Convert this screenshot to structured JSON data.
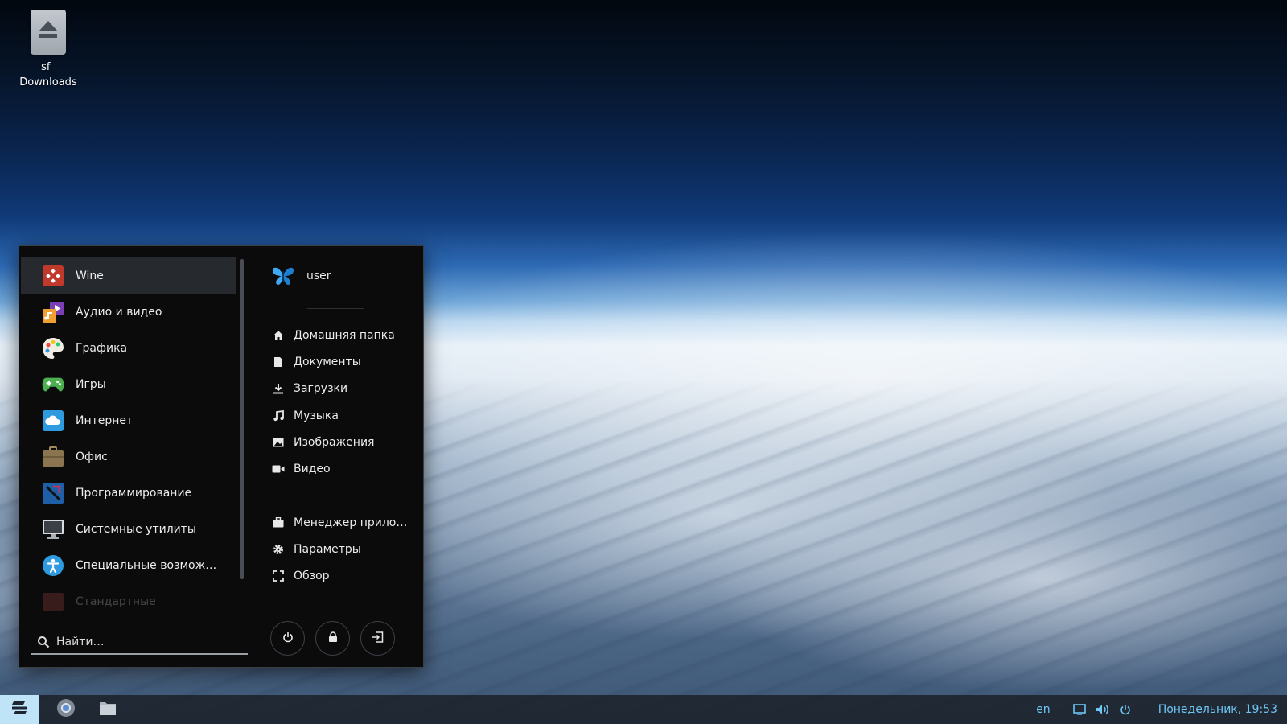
{
  "desktop": {
    "icon": {
      "label_line1": "sf_",
      "label_line2": "Downloads",
      "icon": "eject-drive-icon"
    }
  },
  "menu": {
    "categories": [
      {
        "label": "Wine",
        "icon": "wine-icon",
        "active": true
      },
      {
        "label": "Аудио и видео",
        "icon": "audio-video-icon"
      },
      {
        "label": "Графика",
        "icon": "palette-icon"
      },
      {
        "label": "Игры",
        "icon": "gamepad-icon"
      },
      {
        "label": "Интернет",
        "icon": "cloud-icon"
      },
      {
        "label": "Офис",
        "icon": "briefcase-icon"
      },
      {
        "label": "Программирование",
        "icon": "programming-icon"
      },
      {
        "label": "Системные утилиты",
        "icon": "monitor-icon"
      },
      {
        "label": "Специальные возмож…",
        "icon": "accessibility-icon"
      },
      {
        "label": "Стандартные",
        "icon": "accessories-icon"
      }
    ],
    "search": {
      "placeholder": "Найти…"
    },
    "user": {
      "name": "user",
      "icon": "butterfly-icon"
    },
    "places": [
      {
        "label": "Домашняя папка",
        "icon": "home-icon"
      },
      {
        "label": "Документы",
        "icon": "document-icon"
      },
      {
        "label": "Загрузки",
        "icon": "download-icon"
      },
      {
        "label": "Музыка",
        "icon": "music-icon"
      },
      {
        "label": "Изображения",
        "icon": "image-icon"
      },
      {
        "label": "Видео",
        "icon": "video-icon"
      }
    ],
    "system": [
      {
        "label": "Менеджер прило…",
        "icon": "software-icon"
      },
      {
        "label": "Параметры",
        "icon": "gear-icon"
      },
      {
        "label": "Обзор",
        "icon": "overview-icon"
      }
    ],
    "actions": [
      "power-icon",
      "lock-icon",
      "logout-icon"
    ]
  },
  "taskbar": {
    "start_icon": "zorin-logo-icon",
    "apps": [
      "chrome-icon",
      "files-icon"
    ],
    "lang": "en",
    "tray": [
      "display-icon",
      "volume-icon",
      "power-icon"
    ],
    "clock": "Понедельник, 19:53"
  },
  "colors": {
    "accent": "#6ec6f5",
    "menu_bg": "#0b0b0c",
    "active_row": "#26292d"
  }
}
